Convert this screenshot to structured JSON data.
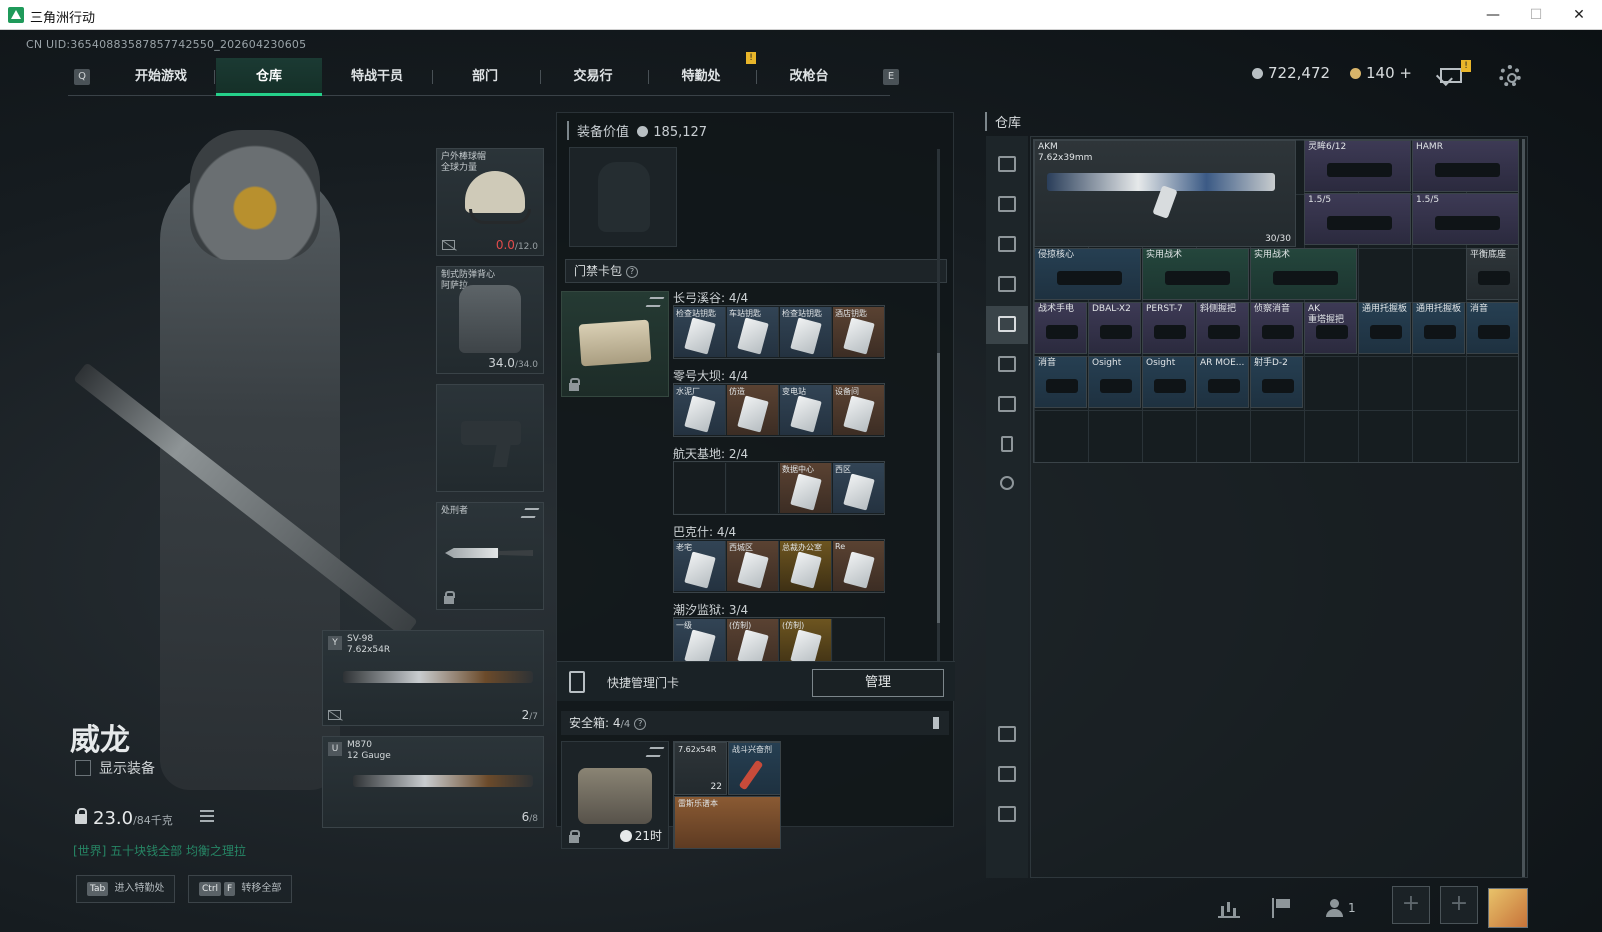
{
  "window": {
    "title": "三角洲行动",
    "minimize": "—",
    "maximize": "☐",
    "close": "✕"
  },
  "uid": "CN UID:36540883587857742550_202604230605",
  "nav": {
    "left_key": "Q",
    "right_key": "E",
    "tabs": [
      "开始游戏",
      "仓库",
      "特战干员",
      "部门",
      "交易行",
      "特勤处",
      "改枪台"
    ],
    "active_tab": "仓库",
    "alert_flag": "!"
  },
  "currency": {
    "silver": "722,472",
    "gold": "140",
    "gold_add": "+"
  },
  "mail_flag": "!",
  "operator": {
    "name": "威龙",
    "show_gear_label": "显示装备",
    "weight": "23.0",
    "weight_max": "/84千克",
    "world_chat": "[世界] 五十块钱全部 均衡之理拉"
  },
  "bottom_hints": [
    {
      "keys": [
        "Tab"
      ],
      "label": "进入特勤处"
    },
    {
      "keys": [
        "Ctrl",
        "F"
      ],
      "label": "转移全部"
    }
  ],
  "gear": {
    "helmet": {
      "label": "户外棒球帽\n全球力量",
      "durability": "0.0",
      "durability_max": "/12.0"
    },
    "armor": {
      "label": "制式防弹背心\n阿萨拉",
      "durability": "34.0",
      "durability_max": "/34.0"
    },
    "melee": {
      "label": "处刑者"
    },
    "primary": {
      "key": "Y",
      "name": "SV-98",
      "ammo_type": "7.62x54R",
      "ammo": "2",
      "ammo_max": "/7"
    },
    "secondary": {
      "key": "U",
      "name": "M870",
      "ammo_type": "12 Gauge",
      "ammo": "6",
      "ammo_max": "/8"
    }
  },
  "middle": {
    "value_label": "装备价值",
    "value": "185,127",
    "keycard_label": "门禁卡包",
    "help": "?",
    "card_groups": [
      {
        "title": "长弓溪谷: 4/4",
        "cards": [
          {
            "name": "检查站钥匙",
            "color": "blue"
          },
          {
            "name": "车站钥匙",
            "color": "blue"
          },
          {
            "name": "检查站钥匙",
            "color": "blue"
          },
          {
            "name": "酒店钥匙",
            "color": "brown"
          }
        ]
      },
      {
        "title": "零号大坝: 4/4",
        "cards": [
          {
            "name": "水泥厂",
            "color": "blue"
          },
          {
            "name": "仿造",
            "color": "brown"
          },
          {
            "name": "变电站",
            "color": "blue"
          },
          {
            "name": "设备间",
            "color": "brown"
          }
        ]
      },
      {
        "title": "航天基地: 2/4",
        "cards": [
          {
            "name": "",
            "color": "empty"
          },
          {
            "name": "",
            "color": "empty"
          },
          {
            "name": "数据中心",
            "color": "brown"
          },
          {
            "name": "西区",
            "color": "blue"
          }
        ]
      },
      {
        "title": "巴克什: 4/4",
        "cards": [
          {
            "name": "老宅",
            "color": "blue"
          },
          {
            "name": "西城区",
            "color": "brown"
          },
          {
            "name": "总裁办公室",
            "color": "gold"
          },
          {
            "name": "Re",
            "color": "brown"
          }
        ]
      },
      {
        "title": "潮汐监狱: 3/4",
        "cards": [
          {
            "name": "一级",
            "color": "blue"
          },
          {
            "name": "(仿制)",
            "color": "brown"
          },
          {
            "name": "(仿制)",
            "color": "gold"
          },
          {
            "name": "",
            "color": "empty"
          }
        ]
      }
    ],
    "quick_label": "快捷管理门卡",
    "manage_label": "管理",
    "safe_label": "安全箱:",
    "safe_count": "4",
    "safe_max": "/4",
    "safe_timer": "21时",
    "safe_items": {
      "ammo": "7.62x54R",
      "ammo_count": "22",
      "stim": "战斗兴奋剂",
      "bag": "雷斯乐谱本"
    }
  },
  "stash": {
    "title": "仓库",
    "rifle": {
      "name": "AKM",
      "caliber": "7.62x39mm",
      "ammo": "30/30"
    },
    "items": [
      {
        "name": "灵眸6/12",
        "color": "purple"
      },
      {
        "name": "HAMR",
        "color": "purple"
      },
      {
        "name": "1.5/5",
        "color": "purple"
      },
      {
        "name": "1.5/5",
        "color": "purple"
      },
      {
        "name": "侵掠核心",
        "color": "blue"
      },
      {
        "name": "实用战术",
        "color": "green"
      },
      {
        "name": "实用战术",
        "color": "green"
      },
      {
        "name": "平衡底座",
        "color": "grey"
      },
      {
        "name": "战术手电",
        "color": "purple"
      },
      {
        "name": "DBAL-X2",
        "color": "purple"
      },
      {
        "name": "PERST-7",
        "color": "purple"
      },
      {
        "name": "斜侧握把",
        "color": "purple"
      },
      {
        "name": "侦察消音",
        "color": "purple"
      },
      {
        "name": "AK\n重塔握把",
        "color": "purple"
      },
      {
        "name": "通用托握板",
        "color": "blue"
      },
      {
        "name": "通用托握板",
        "color": "blue"
      },
      {
        "name": "消音",
        "color": "blue"
      },
      {
        "name": "消音",
        "color": "blue"
      },
      {
        "name": "Osight",
        "color": "blue"
      },
      {
        "name": "Osight",
        "color": "blue"
      },
      {
        "name": "AR MOE...",
        "color": "blue"
      },
      {
        "name": "射手D-2",
        "color": "blue"
      }
    ]
  },
  "social": {
    "friends": "1",
    "add": "+"
  }
}
